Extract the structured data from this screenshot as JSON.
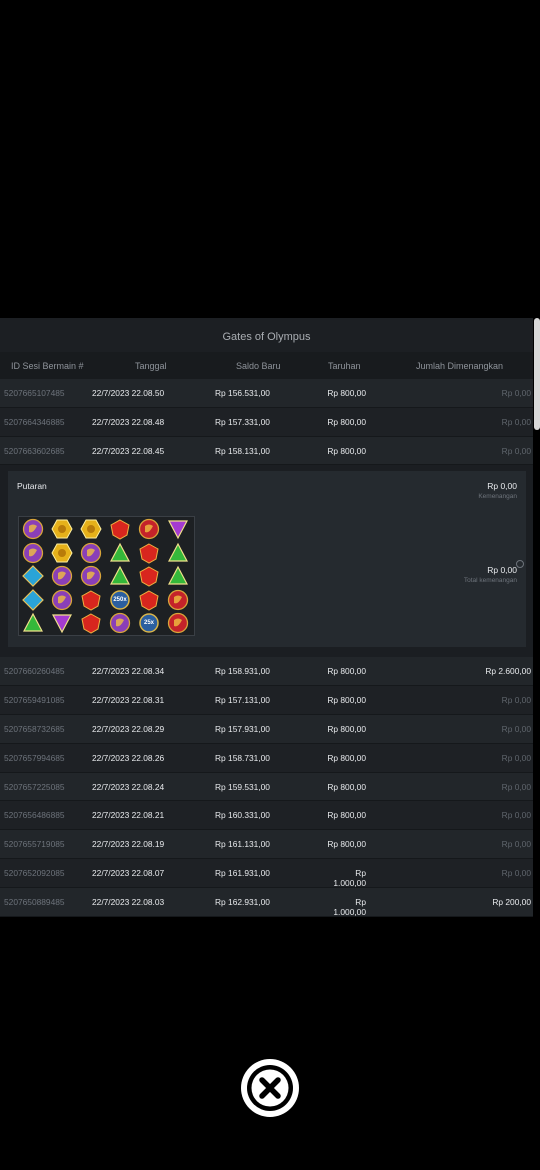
{
  "title": "Gates of Olympus",
  "columns": [
    "ID Sesi Bermain #",
    "Tanggal",
    "Saldo Baru",
    "Taruhan",
    "Jumlah Dimenangkan"
  ],
  "rows_top": [
    {
      "id": "5207665107485",
      "date": "22/7/2023 22.08.50",
      "balance": "Rp 156.531,00",
      "bet": "Rp 800,00",
      "win": "Rp 0,00",
      "win_positive": false
    },
    {
      "id": "5207664346885",
      "date": "22/7/2023 22.08.48",
      "balance": "Rp 157.331,00",
      "bet": "Rp 800,00",
      "win": "Rp 0,00",
      "win_positive": false
    },
    {
      "id": "5207663602685",
      "date": "22/7/2023 22.08.45",
      "balance": "Rp 158.131,00",
      "bet": "Rp 800,00",
      "win": "Rp 0,00",
      "win_positive": false
    }
  ],
  "detail": {
    "label": "Putaran",
    "win": "Rp 0,00",
    "win_sub": "Kemenangan",
    "total": "Rp 0,00",
    "total_sub": "Total kemenangan",
    "multipliers": [
      "250x",
      "25x"
    ]
  },
  "rows_bottom": [
    {
      "id": "5207660260485",
      "date": "22/7/2023 22.08.34",
      "balance": "Rp 158.931,00",
      "bet": "Rp 800,00",
      "win": "Rp 2.600,00",
      "win_positive": true
    },
    {
      "id": "5207659491085",
      "date": "22/7/2023 22.08.31",
      "balance": "Rp 157.131,00",
      "bet": "Rp 800,00",
      "win": "Rp 0,00",
      "win_positive": false
    },
    {
      "id": "5207658732685",
      "date": "22/7/2023 22.08.29",
      "balance": "Rp 157.931,00",
      "bet": "Rp 800,00",
      "win": "Rp 0,00",
      "win_positive": false
    },
    {
      "id": "5207657994685",
      "date": "22/7/2023 22.08.26",
      "balance": "Rp 158.731,00",
      "bet": "Rp 800,00",
      "win": "Rp 0,00",
      "win_positive": false
    },
    {
      "id": "5207657225085",
      "date": "22/7/2023 22.08.24",
      "balance": "Rp 159.531,00",
      "bet": "Rp 800,00",
      "win": "Rp 0,00",
      "win_positive": false
    },
    {
      "id": "5207656486885",
      "date": "22/7/2023 22.08.21",
      "balance": "Rp 160.331,00",
      "bet": "Rp 800,00",
      "win": "Rp 0,00",
      "win_positive": false
    },
    {
      "id": "5207655719085",
      "date": "22/7/2023 22.08.19",
      "balance": "Rp 161.131,00",
      "bet": "Rp 800,00",
      "win": "Rp 0,00",
      "win_positive": false
    },
    {
      "id": "5207652092085",
      "date": "22/7/2023 22.08.07",
      "balance": "Rp 161.931,00",
      "bet": "Rp 1.000,00",
      "win": "Rp 0,00",
      "win_positive": false
    },
    {
      "id": "5207650889485",
      "date": "22/7/2023 22.08.03",
      "balance": "Rp 162.931,00",
      "bet": "Rp 1.000,00",
      "win": "Rp 200,00",
      "win_positive": true
    }
  ],
  "gems": [
    [
      "hourglass",
      "ring",
      "ring",
      "heart",
      "chalice",
      "crown-tri"
    ],
    [
      "hourglass",
      "ring",
      "hourglass",
      "green-tri",
      "heart",
      "green-tri"
    ],
    [
      "blue-diamond",
      "hourglass",
      "hourglass",
      "green-tri",
      "heart",
      "green-tri"
    ],
    [
      "blue-diamond",
      "hourglass",
      "heart",
      "multiplier",
      "heart",
      "chalice"
    ],
    [
      "green-tri",
      "crown-tri",
      "heart",
      "hourglass",
      "multiplier",
      "chalice"
    ]
  ],
  "gem_colors": {
    "hourglass": "#8a3fb8",
    "ring": "#e6b11a",
    "heart": "#d8261e",
    "chalice": "#c4232a",
    "green-tri": "#35b83a",
    "crown-tri": "#a43bd1",
    "blue-diamond": "#2aa4d8",
    "multiplier": "#2b5fa0"
  },
  "close_icon": "close-circle-icon"
}
